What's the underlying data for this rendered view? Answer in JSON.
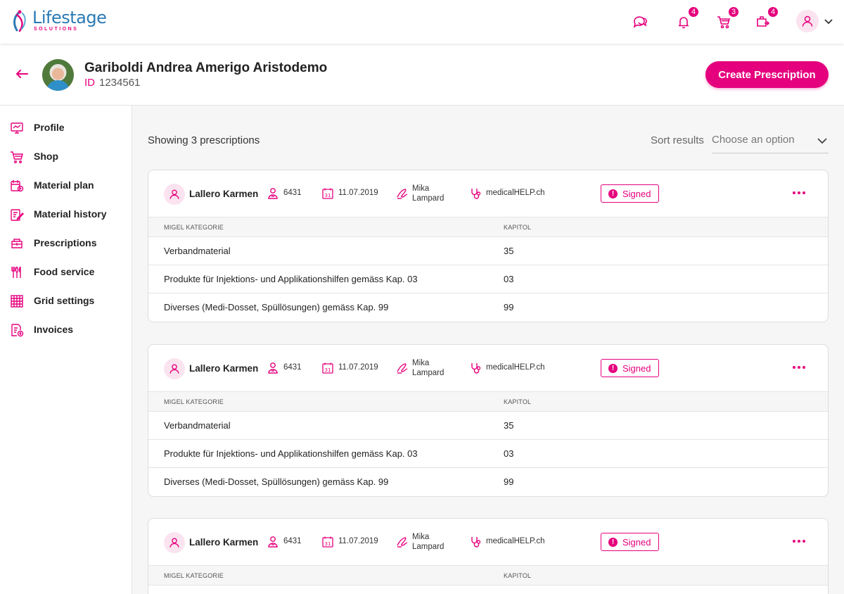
{
  "brand": {
    "name": "Lifestage",
    "sub": "SOLUTIONS"
  },
  "topbar": {
    "icons": [
      {
        "name": "chat-icon",
        "badge": ""
      },
      {
        "name": "bell-icon",
        "badge": "4"
      },
      {
        "name": "cart-icon",
        "badge": "3"
      },
      {
        "name": "delivery-icon",
        "badge": "4"
      }
    ]
  },
  "patient": {
    "name": "Gariboldi Andrea Amerigo Aristodemo",
    "id_label": "ID",
    "id": "1234561"
  },
  "create_button": "Create Prescription",
  "sidebar": {
    "items": [
      {
        "label": "Profile",
        "icon": "monitor-icon"
      },
      {
        "label": "Shop",
        "icon": "cart-icon"
      },
      {
        "label": "Material plan",
        "icon": "calendar-plan-icon"
      },
      {
        "label": "Material history",
        "icon": "edit-list-icon"
      },
      {
        "label": "Prescriptions",
        "icon": "prescription-icon"
      },
      {
        "label": "Food service",
        "icon": "cutlery-icon"
      },
      {
        "label": "Grid settings",
        "icon": "grid-icon"
      },
      {
        "label": "Invoices",
        "icon": "invoice-icon"
      }
    ]
  },
  "results": {
    "showing": "Showing 3 prescriptions",
    "sort_label": "Sort results",
    "sort_placeholder": "Choose an option"
  },
  "prescriptions": [
    {
      "person": "Lallero Karmen",
      "patient_number": "6431",
      "date": "11.07.2019",
      "doctor_first": "Mika",
      "doctor_last": "Lampard",
      "organization": "medicalHELP.ch",
      "status": "Signed",
      "columns": [
        "MIGEL KATEGORIE",
        "KAPITOL"
      ],
      "rows": [
        {
          "category": "Verbandmaterial",
          "chapter": "35"
        },
        {
          "category": "Produkte für Injektions- und Applikationshilfen gemäss Kap. 03",
          "chapter": "03"
        },
        {
          "category": "Diverses (Medi-Dosset, Spüllösungen) gemäss Kap. 99",
          "chapter": "99"
        }
      ]
    },
    {
      "person": "Lallero Karmen",
      "patient_number": "6431",
      "date": "11.07.2019",
      "doctor_first": "Mika",
      "doctor_last": "Lampard",
      "organization": "medicalHELP.ch",
      "status": "Signed",
      "columns": [
        "MIGEL KATEGORIE",
        "KAPITOL"
      ],
      "rows": [
        {
          "category": "Verbandmaterial",
          "chapter": "35"
        },
        {
          "category": "Produkte für Injektions- und Applikationshilfen gemäss Kap. 03",
          "chapter": "03"
        },
        {
          "category": "Diverses (Medi-Dosset, Spüllösungen) gemäss Kap. 99",
          "chapter": "99"
        }
      ]
    },
    {
      "person": "Lallero Karmen",
      "patient_number": "6431",
      "date": "11.07.2019",
      "doctor_first": "Mika",
      "doctor_last": "Lampard",
      "organization": "medicalHELP.ch",
      "status": "Signed",
      "columns": [
        "MIGEL KATEGORIE",
        "KAPITOL"
      ],
      "rows": []
    }
  ],
  "colors": {
    "accent": "#e5007d",
    "brand_blue": "#2b7ab5",
    "accent_light": "#fbe3ef"
  }
}
